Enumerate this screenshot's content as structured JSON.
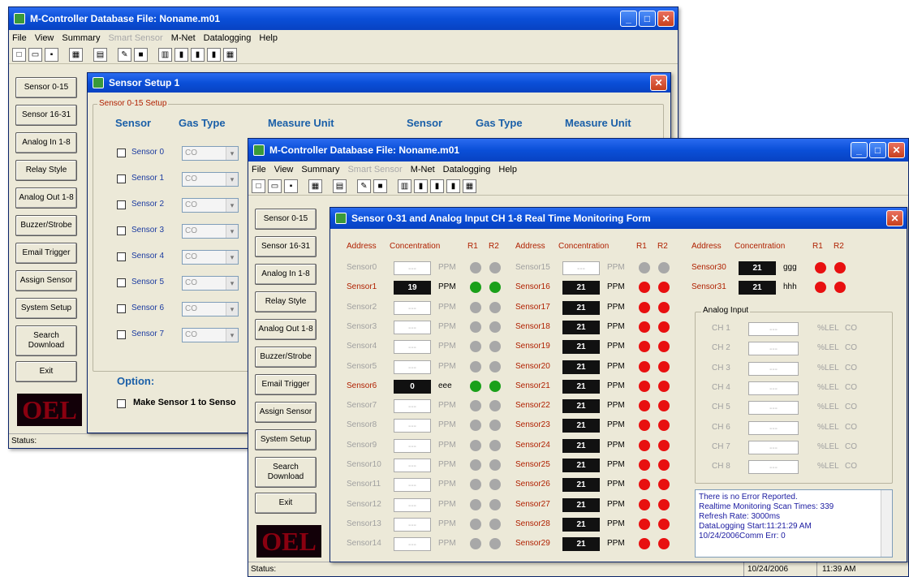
{
  "back_window": {
    "title": "M-Controller Database File: Noname.m01",
    "status": "Status:"
  },
  "menu": {
    "items": [
      "File",
      "View",
      "Summary",
      "Smart Sensor",
      "M-Net",
      "Datalogging",
      "Help"
    ],
    "disabled_index": 3
  },
  "sidebar": {
    "buttons": [
      "Sensor 0-15",
      "Sensor 16-31",
      "Analog In 1-8",
      "Relay Style",
      "Analog Out 1-8",
      "Buzzer/Strobe",
      "Email Trigger",
      "Assign Sensor",
      "System Setup",
      "Search Download",
      "Exit"
    ],
    "logo": "OEL"
  },
  "setup": {
    "title": "Sensor Setup 1",
    "group": "Sensor 0-15 Setup",
    "headers": [
      "Sensor",
      "Gas Type",
      "Measure Unit",
      "Sensor",
      "Gas Type",
      "Measure Unit"
    ],
    "sensors": [
      "Sensor 0",
      "Sensor 1",
      "Sensor 2",
      "Sensor 3",
      "Sensor 4",
      "Sensor 5",
      "Sensor 6",
      "Sensor 7"
    ],
    "gas_placeholder": "CO",
    "option_label": "Option:",
    "option_text": "Make Sensor 1 to Senso"
  },
  "front_window": {
    "title": "M-Controller Database File: Noname.m01",
    "status": "Status:",
    "date": "10/24/2006",
    "time": "11:39 AM"
  },
  "monitor": {
    "title": "Sensor 0-31 and Analog Input CH 1-8 Real Time Monitoring Form",
    "col_headers": {
      "address": "Address",
      "concentration": "Concentration",
      "r1": "R1",
      "r2": "R2"
    },
    "col1": [
      {
        "name": "Sensor0",
        "val": "---",
        "unit": "PPM",
        "r1": "gray",
        "r2": "gray",
        "active": false
      },
      {
        "name": "Sensor1",
        "val": "19",
        "unit": "PPM",
        "r1": "green",
        "r2": "green",
        "active": true
      },
      {
        "name": "Sensor2",
        "val": "---",
        "unit": "PPM",
        "r1": "gray",
        "r2": "gray",
        "active": false
      },
      {
        "name": "Sensor3",
        "val": "---",
        "unit": "PPM",
        "r1": "gray",
        "r2": "gray",
        "active": false
      },
      {
        "name": "Sensor4",
        "val": "---",
        "unit": "PPM",
        "r1": "gray",
        "r2": "gray",
        "active": false
      },
      {
        "name": "Sensor5",
        "val": "---",
        "unit": "PPM",
        "r1": "gray",
        "r2": "gray",
        "active": false
      },
      {
        "name": "Sensor6",
        "val": "0",
        "unit": "eee",
        "r1": "green",
        "r2": "green",
        "active": true
      },
      {
        "name": "Sensor7",
        "val": "---",
        "unit": "PPM",
        "r1": "gray",
        "r2": "gray",
        "active": false
      },
      {
        "name": "Sensor8",
        "val": "---",
        "unit": "PPM",
        "r1": "gray",
        "r2": "gray",
        "active": false
      },
      {
        "name": "Sensor9",
        "val": "---",
        "unit": "PPM",
        "r1": "gray",
        "r2": "gray",
        "active": false
      },
      {
        "name": "Sensor10",
        "val": "---",
        "unit": "PPM",
        "r1": "gray",
        "r2": "gray",
        "active": false
      },
      {
        "name": "Sensor11",
        "val": "---",
        "unit": "PPM",
        "r1": "gray",
        "r2": "gray",
        "active": false
      },
      {
        "name": "Sensor12",
        "val": "---",
        "unit": "PPM",
        "r1": "gray",
        "r2": "gray",
        "active": false
      },
      {
        "name": "Sensor13",
        "val": "---",
        "unit": "PPM",
        "r1": "gray",
        "r2": "gray",
        "active": false
      },
      {
        "name": "Sensor14",
        "val": "---",
        "unit": "PPM",
        "r1": "gray",
        "r2": "gray",
        "active": false
      }
    ],
    "col2": [
      {
        "name": "Sensor15",
        "val": "---",
        "unit": "PPM",
        "r1": "gray",
        "r2": "gray",
        "active": false
      },
      {
        "name": "Sensor16",
        "val": "21",
        "unit": "PPM",
        "r1": "red",
        "r2": "red",
        "active": true
      },
      {
        "name": "Sensor17",
        "val": "21",
        "unit": "PPM",
        "r1": "red",
        "r2": "red",
        "active": true
      },
      {
        "name": "Sensor18",
        "val": "21",
        "unit": "PPM",
        "r1": "red",
        "r2": "red",
        "active": true
      },
      {
        "name": "Sensor19",
        "val": "21",
        "unit": "PPM",
        "r1": "red",
        "r2": "red",
        "active": true
      },
      {
        "name": "Sensor20",
        "val": "21",
        "unit": "PPM",
        "r1": "red",
        "r2": "red",
        "active": true
      },
      {
        "name": "Sensor21",
        "val": "21",
        "unit": "PPM",
        "r1": "red",
        "r2": "red",
        "active": true
      },
      {
        "name": "Sensor22",
        "val": "21",
        "unit": "PPM",
        "r1": "red",
        "r2": "red",
        "active": true
      },
      {
        "name": "Sensor23",
        "val": "21",
        "unit": "PPM",
        "r1": "red",
        "r2": "red",
        "active": true
      },
      {
        "name": "Sensor24",
        "val": "21",
        "unit": "PPM",
        "r1": "red",
        "r2": "red",
        "active": true
      },
      {
        "name": "Sensor25",
        "val": "21",
        "unit": "PPM",
        "r1": "red",
        "r2": "red",
        "active": true
      },
      {
        "name": "Sensor26",
        "val": "21",
        "unit": "PPM",
        "r1": "red",
        "r2": "red",
        "active": true
      },
      {
        "name": "Sensor27",
        "val": "21",
        "unit": "PPM",
        "r1": "red",
        "r2": "red",
        "active": true
      },
      {
        "name": "Sensor28",
        "val": "21",
        "unit": "PPM",
        "r1": "red",
        "r2": "red",
        "active": true
      },
      {
        "name": "Sensor29",
        "val": "21",
        "unit": "PPM",
        "r1": "red",
        "r2": "red",
        "active": true
      }
    ],
    "col3": [
      {
        "name": "Sensor30",
        "val": "21",
        "unit": "ggg",
        "r1": "red",
        "r2": "red",
        "active": true
      },
      {
        "name": "Sensor31",
        "val": "21",
        "unit": "hhh",
        "r1": "red",
        "r2": "red",
        "active": true
      }
    ],
    "analog_title": "Analog Input",
    "analog": [
      {
        "ch": "CH 1",
        "val": "---",
        "unit": "%LEL",
        "gas": "CO"
      },
      {
        "ch": "CH 2",
        "val": "---",
        "unit": "%LEL",
        "gas": "CO"
      },
      {
        "ch": "CH 3",
        "val": "---",
        "unit": "%LEL",
        "gas": "CO"
      },
      {
        "ch": "CH 4",
        "val": "---",
        "unit": "%LEL",
        "gas": "CO"
      },
      {
        "ch": "CH 5",
        "val": "---",
        "unit": "%LEL",
        "gas": "CO"
      },
      {
        "ch": "CH 6",
        "val": "---",
        "unit": "%LEL",
        "gas": "CO"
      },
      {
        "ch": "CH 7",
        "val": "---",
        "unit": "%LEL",
        "gas": "CO"
      },
      {
        "ch": "CH 8",
        "val": "---",
        "unit": "%LEL",
        "gas": "CO"
      }
    ],
    "log": [
      "There is no Error Reported.",
      "Realtime Monitoring Scan Times: 339",
      "Refresh Rate: 3000ms",
      "DataLogging Start:11:21:29 AM",
      "10/24/2006Comm Err: 0"
    ]
  },
  "colors": {
    "titlebar": "#0a4fd8",
    "active_sensor": "#b02000",
    "inactive": "#a0a0a0"
  }
}
